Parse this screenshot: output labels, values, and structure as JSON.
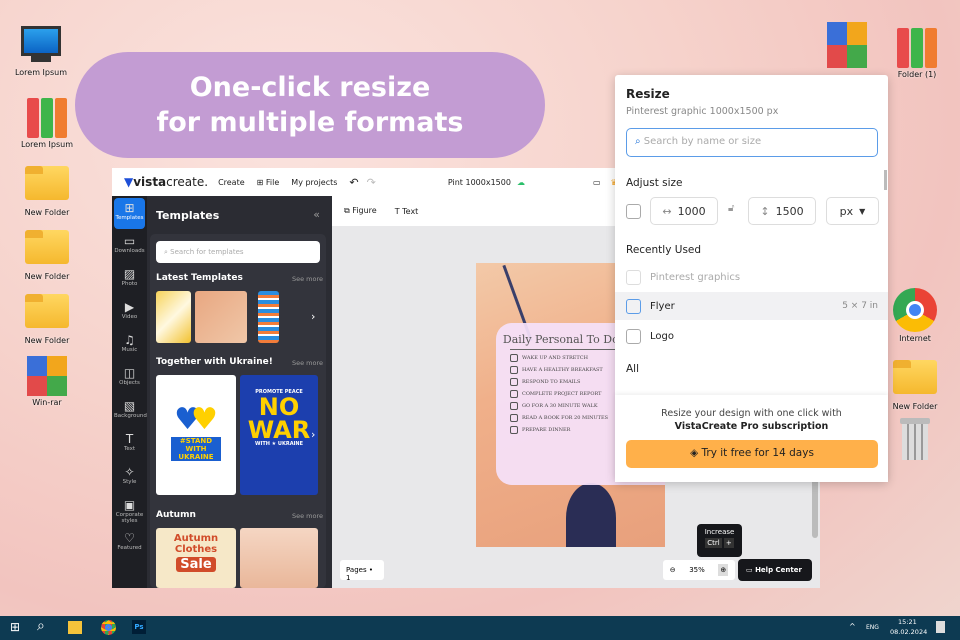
{
  "desktop": {
    "left_icons": [
      {
        "label": "Lorem Ipsum",
        "icon": "computer-icon"
      },
      {
        "label": "Lorem Ipsum",
        "icon": "binders-icon"
      },
      {
        "label": "New Folder",
        "icon": "folder-icon"
      },
      {
        "label": "New Folder",
        "icon": "folder-icon"
      },
      {
        "label": "New Folder",
        "icon": "folder-icon"
      },
      {
        "label": "Win-rar",
        "icon": "winrar-icon"
      }
    ],
    "right_icons": [
      {
        "label": "Folder (1)"
      },
      {
        "label": "Internet"
      },
      {
        "label": "New Folder"
      }
    ]
  },
  "banner": {
    "line1": "One-click resize",
    "line2": "for multiple formats"
  },
  "app": {
    "logo_bold": "vista",
    "logo_light": "create.",
    "nav": [
      "Create",
      "File",
      "My projects"
    ],
    "doc_title": "Pint 1000x1500",
    "rail": [
      "Templates",
      "Downloads",
      "Photo",
      "Video",
      "Music",
      "Objects",
      "Background",
      "Text",
      "Style",
      "Corporate styles",
      "Featured"
    ],
    "panel": {
      "title": "Templates",
      "search_placeholder": "Search for templates",
      "sections": [
        {
          "title": "Latest Templates",
          "see_more": "See more"
        },
        {
          "title": "Together with Ukraine!",
          "see_more": "See more"
        },
        {
          "title": "Autumn",
          "see_more": "See more"
        }
      ],
      "thumb_texts": {
        "stand": "#STAND WITH UKRAINE",
        "promote": "PROMOTE PEACE",
        "nowar1": "NO",
        "nowar2": "WAR",
        "withukraine": "WITH ★ UKRAINE",
        "autumn": "Autumn Clothes",
        "sale": "Sale"
      }
    },
    "toolbar": {
      "figure": "Figure",
      "text": "Text"
    },
    "design": {
      "title": "Daily Personal To Do List",
      "items": [
        "Wake up and stretch",
        "Have a healthy breakfast",
        "Respond to emails",
        "Complete project report",
        "Go for a 30 minute walk",
        "Read a book for 20 minutes",
        "Prepare dinner"
      ]
    },
    "pages": "Pages • 1",
    "zoom": "35%",
    "tooltip": {
      "label": "Increase",
      "key1": "Ctrl",
      "key2": "+"
    },
    "help": "Help Center"
  },
  "resize": {
    "title": "Resize",
    "subtitle": "Pinterest graphic 1000x1500 px",
    "search_placeholder": "Search by name or size",
    "adjust_label": "Adjust size",
    "width": "1000",
    "height": "1500",
    "unit": "px",
    "recent_label": "Recently Used",
    "recent": [
      {
        "name": "Pinterest graphics",
        "size": "",
        "disabled": true
      },
      {
        "name": "Flyer",
        "size": "5 × 7 in"
      },
      {
        "name": "Logo",
        "size": ""
      }
    ],
    "all_label": "All",
    "promo": "Resize your design with one click with",
    "promo_bold": "VistaCreate Pro subscription",
    "cta": "Try it free for 14 days",
    "accent": "#ffb04a"
  },
  "taskbar": {
    "lang": "ENG",
    "time": "15:21",
    "date": "08.02.2024"
  }
}
